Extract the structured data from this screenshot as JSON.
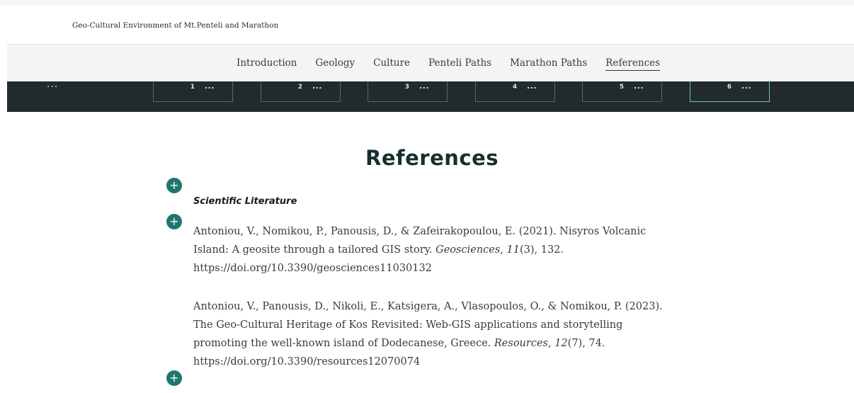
{
  "site": {
    "title": "Geo-Cultural Environment of Mt.Penteli and Marathon"
  },
  "nav": {
    "items": [
      {
        "label": "Introduction"
      },
      {
        "label": "Geology"
      },
      {
        "label": "Culture"
      },
      {
        "label": "Penteli Paths"
      },
      {
        "label": "Marathon Paths"
      },
      {
        "label": "References",
        "active": true
      }
    ]
  },
  "slides": {
    "more_label": "...",
    "items": [
      {
        "number": "1",
        "dots": "..."
      },
      {
        "number": "2",
        "dots": "..."
      },
      {
        "number": "3",
        "dots": "..."
      },
      {
        "number": "4",
        "dots": "..."
      },
      {
        "number": "5",
        "dots": "..."
      },
      {
        "number": "6",
        "dots": "...",
        "active": true
      }
    ]
  },
  "main": {
    "heading": "References",
    "plus_label": "+",
    "section_title": "Scientific Literature",
    "references": [
      {
        "l1": "Antoniou, V., Nomikou, P., Panousis, D., & Zafeirakopoulou, E. (2021). Nisyros Volcanic",
        "l2_a": "Island: A geosite through a tailored GIS story. ",
        "l2_journal": "Geosciences",
        "l2_sep": ", ",
        "l2_volume": "11",
        "l2_b": "(3), 132.",
        "l3": "https://doi.org/10.3390/geosciences11030132"
      },
      {
        "l1": "Antoniou, V., Panousis, D., Nikoli, E., Katsigera, A., Vlasopoulos, O., & Nomikou, P. (2023).",
        "l2": "The Geo-Cultural Heritage of Kos Revisited: Web-GIS applications and storytelling",
        "l3_a": "promoting the well-known island of Dodecanese, Greece. ",
        "l3_journal": "Resources",
        "l3_sep": ", ",
        "l3_volume": "12",
        "l3_b": "(7), 74.",
        "l4": "https://doi.org/10.3390/resources12070074"
      }
    ]
  },
  "colors": {
    "accent": "#1f7670",
    "heading": "#16302f",
    "slide_bar": "#212a2c",
    "active_slide_border": "#6ec1c6"
  }
}
